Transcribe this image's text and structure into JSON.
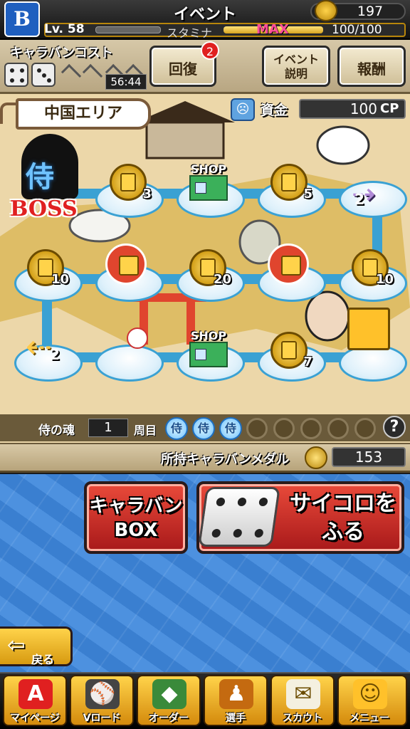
{
  "header": {
    "logo": "B",
    "title": "イベント",
    "coins": "197",
    "level": "Lv. 58",
    "stamina_label": "スタミナ",
    "stamina_max_tag": "MAX",
    "stamina_value": "100/100"
  },
  "caravan": {
    "cost_label": "キャラバンコスト",
    "timer": "56:44",
    "recover_label": "回復",
    "recover_badge": "2",
    "event_info_label_1": "イベント",
    "event_info_label_2": "説明",
    "reward_label": "報酬"
  },
  "board": {
    "area_name": "中国エリア",
    "funds_label": "資金",
    "funds_value": "100",
    "funds_unit": "CP",
    "boss_label": "BOSS",
    "boss_kanji": "侍",
    "shop_label": "SHOP",
    "medals": [
      "3",
      "5",
      "10",
      "20",
      "10",
      "7"
    ],
    "space_numbers": [
      "2",
      "2"
    ]
  },
  "soul": {
    "label": "侍の魂",
    "count": "1",
    "round_label": "周目",
    "icon_char": "侍",
    "filled": 3,
    "total": 8
  },
  "medal_row": {
    "label": "所持キャラバンメダル",
    "value": "153"
  },
  "actions": {
    "box_line_1": "キャラバン",
    "box_line_2": "BOX",
    "dice_line_1": "サイコロを",
    "dice_line_2": "ふる",
    "back_label": "戻る"
  },
  "nav": [
    {
      "label": "マイページ",
      "icon": "A"
    },
    {
      "label": "Vロード",
      "icon": "⚾"
    },
    {
      "label": "オーダー",
      "icon": "◆"
    },
    {
      "label": "選手",
      "icon": "♟"
    },
    {
      "label": "スカウト",
      "icon": "✉"
    },
    {
      "label": "メニュー",
      "icon": "☺"
    }
  ],
  "colors": {
    "board_bg": "#ecd7a9",
    "node_border": "#3aa1d3",
    "accent_red": "#e02020",
    "gold": "#ffd34a",
    "lower_blue": "#3a7fd0"
  }
}
